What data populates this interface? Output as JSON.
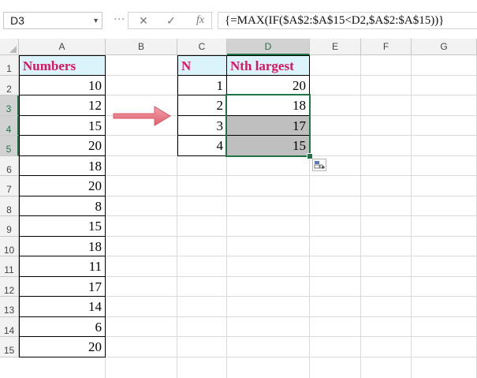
{
  "formula_bar": {
    "name_box": "D3",
    "cancel_icon": "cancel-x-icon",
    "enter_icon": "checkmark-icon",
    "fx_label": "fx",
    "formula": "{=MAX(IF($A$2:$A$15<D2,$A$2:$A$15))}"
  },
  "columns": [
    "A",
    "B",
    "C",
    "D",
    "E",
    "F",
    "G"
  ],
  "rows": [
    "1",
    "2",
    "3",
    "4",
    "5",
    "6",
    "7",
    "8",
    "9",
    "10",
    "11",
    "12",
    "13",
    "14",
    "15"
  ],
  "selected_cell": "D3",
  "numbers_header": "Numbers",
  "numbers": [
    "10",
    "12",
    "15",
    "20",
    "18",
    "20",
    "8",
    "15",
    "18",
    "11",
    "17",
    "14",
    "6",
    "20"
  ],
  "n_header": "N",
  "n_values": [
    "1",
    "2",
    "3",
    "4"
  ],
  "nth_header": "Nth largest",
  "nth_values": [
    "20",
    "18",
    "17",
    "15"
  ],
  "colors": {
    "header_fill": "#dbf3fb",
    "header_text": "#e0115f",
    "selection": "#217346",
    "arrow": "#e8707f",
    "shaded_fill": "#bfbfbf"
  },
  "icons": {
    "arrow": "right-arrow-icon",
    "quick_analysis": "quick-analysis-icon"
  }
}
